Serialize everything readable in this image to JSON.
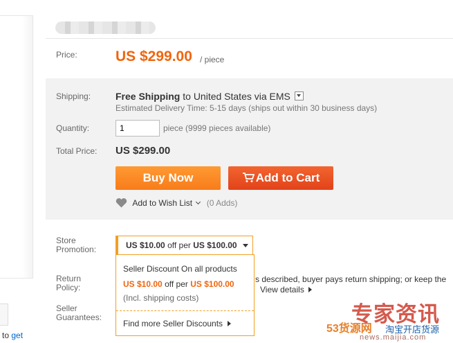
{
  "price": {
    "label": "Price:",
    "value": "US $299.00",
    "unit": "/ piece"
  },
  "shipping": {
    "label": "Shipping:",
    "method": "Free Shipping",
    "to": "to",
    "destination": "United States via EMS",
    "estimate": "Estimated Delivery Time: 5-15 days (ships out within 30 business days)"
  },
  "quantity": {
    "label": "Quantity:",
    "value": "1",
    "note": "piece (9999 pieces available)"
  },
  "total": {
    "label": "Total Price:",
    "value": "US $299.00"
  },
  "buttons": {
    "buy_now": "Buy Now",
    "add_to_cart": "Add to Cart"
  },
  "wishlist": {
    "label": "Add to Wish List",
    "count": "(0 Adds)"
  },
  "store_promotion": {
    "label_line1": "Store",
    "label_line2": "Promotion:",
    "amount": "US $10.00",
    "off_per": "off per",
    "threshold": "US $100.00"
  },
  "promo_panel": {
    "title": "Seller Discount On all products",
    "amount": "US $10.00",
    "off_per": "off per",
    "threshold": "US $100.00",
    "note": "(Incl. shipping costs)",
    "link": "Find more Seller Discounts"
  },
  "return_policy": {
    "label_line1": "Return",
    "label_line2": "Policy:",
    "text_line1": "s described, buyer pays return shipping; or keep the",
    "link": "View details"
  },
  "seller_guarantees": {
    "label_line1": "Seller",
    "label_line2": "Guarantees:"
  },
  "left_text": {
    "to": "to",
    "link": "get"
  },
  "watermark": {
    "brand": "53货源网",
    "tagline": "淘宝开店货源",
    "big": "专家资讯",
    "url": "news.maijia.com"
  },
  "colors": {
    "accent": "#f0650e",
    "buy_now": "#f77c1a",
    "add_to_cart": "#e8491d",
    "promo_border": "#f0a024"
  }
}
